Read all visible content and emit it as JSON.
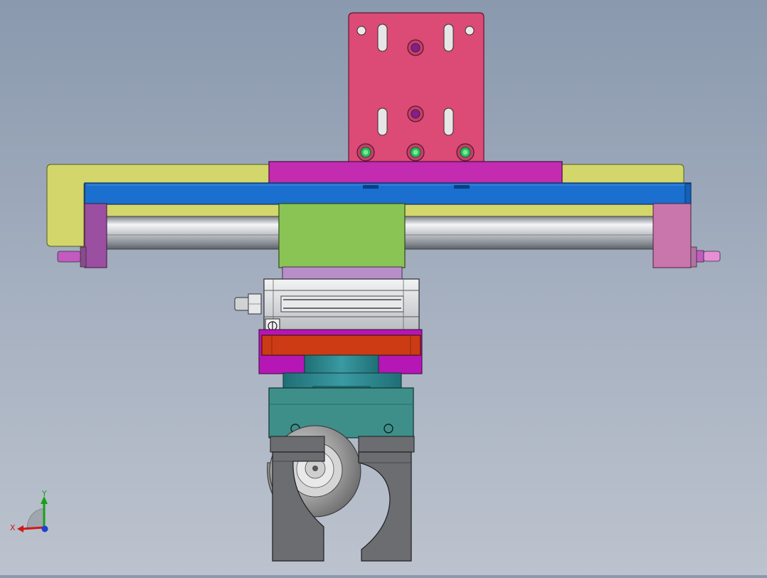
{
  "triad": {
    "x_label": "X",
    "y_label": "Y",
    "x_color": "#d01818",
    "y_color": "#18a018",
    "z_color": "#2040d0"
  },
  "colors": {
    "mount_plate": "#dc4a76",
    "mount_bar": "#c32bb0",
    "frame_yellow": "#d3d66a",
    "beam_blue": "#1a6fcf",
    "end_left": "#9b4fa0",
    "end_right": "#c876ac",
    "carriage_green": "#8ac455",
    "adapter_lilac": "#b88ec8",
    "cylinder_silver": "#d8dadc",
    "flange_orange": "#cc3b14",
    "flange_magenta": "#b516b5",
    "rotary_teal": "#2c8a92",
    "gripper_body": "#3e8f8a",
    "jaw_gray": "#6b6d70",
    "part_disk": "#9a9a9a",
    "port_green": "#22c25a",
    "port_purple": "#8b1a8b"
  }
}
